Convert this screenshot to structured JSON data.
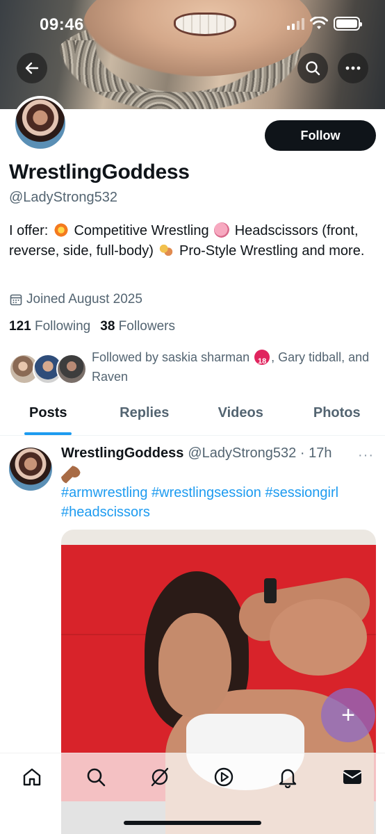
{
  "status_bar": {
    "time": "09:46"
  },
  "header_actions": {
    "back": "back",
    "search": "search",
    "more": "more"
  },
  "profile": {
    "follow_label": "Follow",
    "display_name": "WrestlingGoddess",
    "handle": "@LadyStrong532",
    "bio": {
      "part1": "I offer: ",
      "emoji1": "collision-emoji",
      "part2": " Competitive Wrestling ",
      "emoji2": "brain-emoji",
      "part3": " Headscissors (front, reverse, side, full-body) ",
      "emoji3": "wrestlers-emoji",
      "part4": " Pro-Style Wrestling and more."
    },
    "joined": "Joined August 2025",
    "following_count": "121",
    "following_label": "Following",
    "followers_count": "38",
    "followers_label": "Followers",
    "followed_by": {
      "part1": "Followed by saskia sharman ",
      "badge": "no-one-under-18-emoji",
      "part2": ", Gary tidball, and Raven"
    }
  },
  "tabs": [
    {
      "label": "Posts",
      "active": true
    },
    {
      "label": "Replies",
      "active": false
    },
    {
      "label": "Videos",
      "active": false
    },
    {
      "label": "Photos",
      "active": false
    }
  ],
  "post": {
    "author_name": "WrestlingGoddess",
    "meta": "@LadyStrong532 · 17h",
    "more": "···",
    "emoji": "flexed-biceps-emoji",
    "hashtags": "#armwrestling #wrestlingsession #sessiongirl #headscissors"
  },
  "fab": {
    "symbol": "+"
  },
  "bottom_nav": {
    "items": [
      "home-icon",
      "search-icon",
      "grok-icon",
      "video-icon",
      "notifications-icon",
      "messages-icon"
    ]
  },
  "colors": {
    "accent": "#1d9bf0",
    "text": "#0f1419",
    "secondary": "#536471",
    "follow_bg": "#0f1419"
  }
}
